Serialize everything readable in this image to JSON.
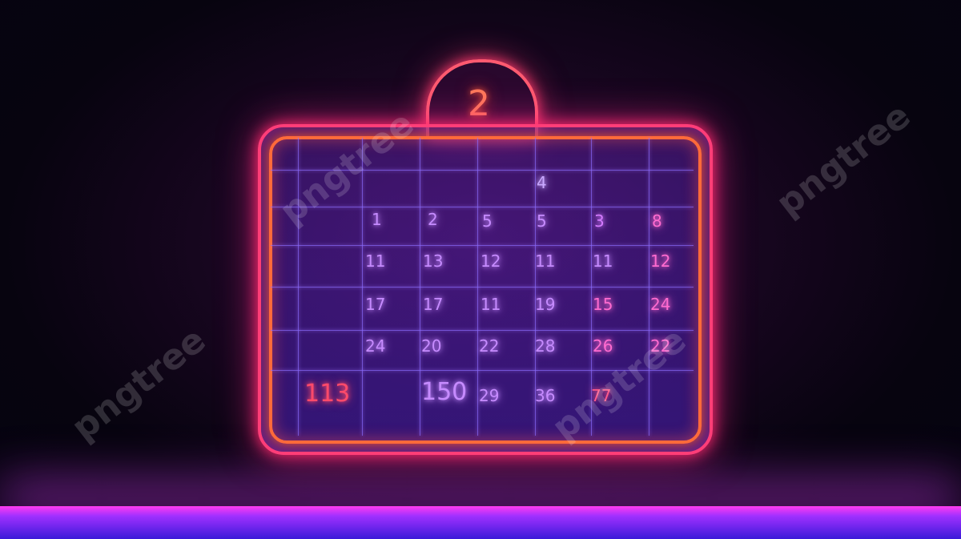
{
  "scene": {
    "tab_number": "2",
    "accent_colors": {
      "pink": "#ff3d7a",
      "orange": "#ff6a3a",
      "violet": "#a030ff",
      "grid": "#8c6eff"
    },
    "cells": [
      {
        "text": "4",
        "color": "#c9a8ff"
      },
      {
        "text": "1",
        "color": "#c68bff"
      },
      {
        "text": "2",
        "color": "#c68bff"
      },
      {
        "text": "5",
        "color": "#c68bff"
      },
      {
        "text": "5",
        "color": "#c68bff"
      },
      {
        "text": "3",
        "color": "#d47bff"
      },
      {
        "text": "8",
        "color": "#ff6bd0"
      },
      {
        "text": "11",
        "color": "#c68bff"
      },
      {
        "text": "13",
        "color": "#c68bff"
      },
      {
        "text": "12",
        "color": "#c68bff"
      },
      {
        "text": "11",
        "color": "#c68bff"
      },
      {
        "text": "11",
        "color": "#c68bff"
      },
      {
        "text": "12",
        "color": "#ff6bd0"
      },
      {
        "text": "17",
        "color": "#c68bff"
      },
      {
        "text": "17",
        "color": "#c68bff"
      },
      {
        "text": "11",
        "color": "#c68bff"
      },
      {
        "text": "19",
        "color": "#c68bff"
      },
      {
        "text": "15",
        "color": "#ff6bd0"
      },
      {
        "text": "24",
        "color": "#ff6bd0"
      },
      {
        "text": "24",
        "color": "#c68bff"
      },
      {
        "text": "20",
        "color": "#c68bff"
      },
      {
        "text": "22",
        "color": "#c68bff"
      },
      {
        "text": "28",
        "color": "#c68bff"
      },
      {
        "text": "26",
        "color": "#ff6bd0"
      },
      {
        "text": "22",
        "color": "#ff6bd0"
      },
      {
        "text": "113",
        "color": "#ff4a6a"
      },
      {
        "text": "150",
        "color": "#c68bff"
      },
      {
        "text": "29",
        "color": "#c68bff"
      },
      {
        "text": "36",
        "color": "#c68bff"
      },
      {
        "text": "77",
        "color": "#ff5a8a"
      }
    ],
    "watermark": "pngtree"
  }
}
